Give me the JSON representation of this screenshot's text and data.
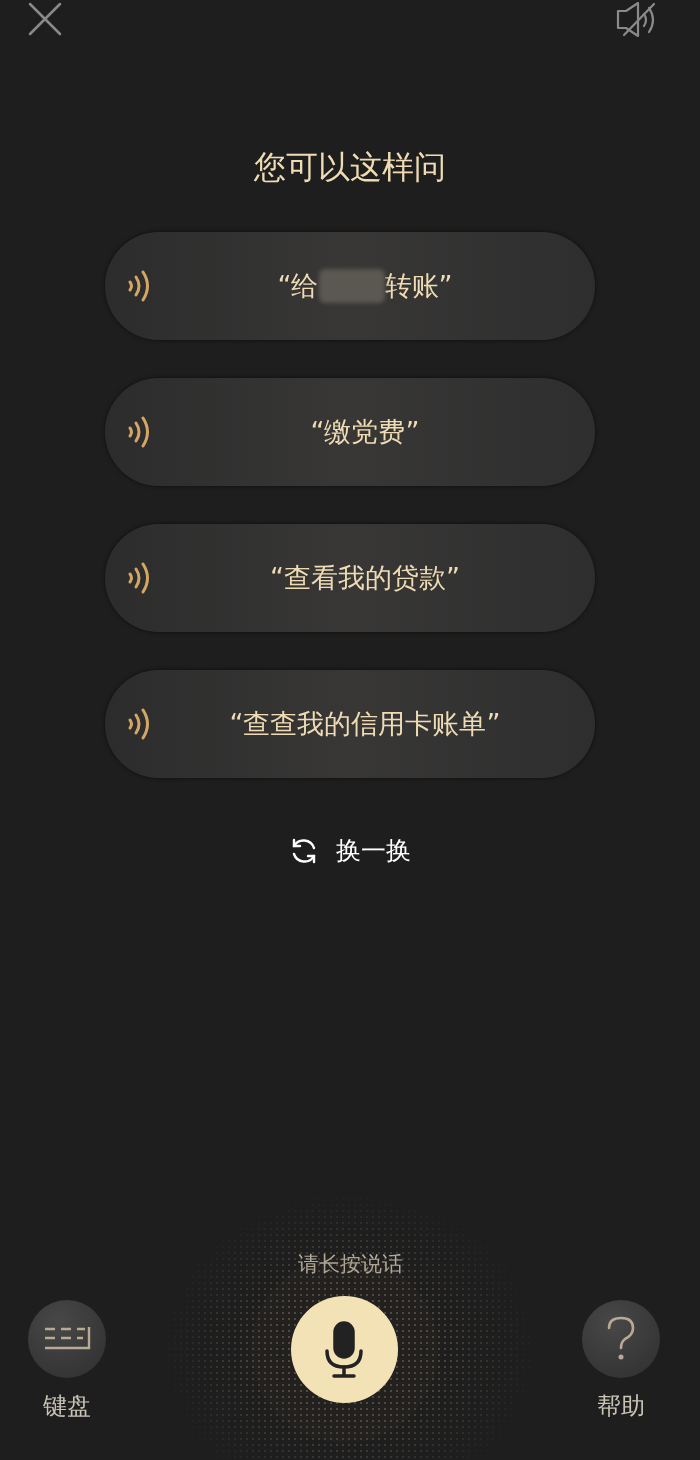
{
  "title": "您可以这样问",
  "suggestions": [
    {
      "text_before": "“给",
      "text_after": "转账”",
      "redacted": true
    },
    {
      "text_before": "“缴党费”",
      "redacted": false
    },
    {
      "text_before": "“查看我的贷款”",
      "redacted": false
    },
    {
      "text_before": "“查查我的信用卡账单”",
      "redacted": false
    }
  ],
  "refresh_label": "换一换",
  "hint": "请长按说话",
  "keyboard_label": "键盘",
  "help_label": "帮助"
}
